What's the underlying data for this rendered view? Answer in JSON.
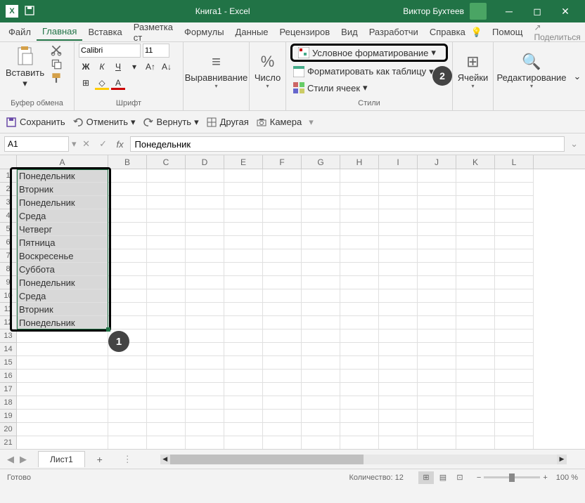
{
  "titlebar": {
    "doc_title": "Книга1",
    "app_name": "Excel",
    "user_name": "Виктор Бухтеев"
  },
  "menubar": {
    "items": [
      "Файл",
      "Главная",
      "Вставка",
      "Разметка ст",
      "Формулы",
      "Данные",
      "Рецензиров",
      "Вид",
      "Разработчи",
      "Справка"
    ],
    "active_index": 1,
    "help_label": "Помощ",
    "share_label": "Поделиться"
  },
  "ribbon": {
    "clipboard": {
      "paste": "Вставить",
      "label": "Буфер обмена"
    },
    "font": {
      "name": "Calibri",
      "size": "11",
      "label": "Шрифт",
      "bold": "Ж",
      "italic": "К",
      "underline": "Ч"
    },
    "alignment": {
      "label": "Выравнивание"
    },
    "number": {
      "label": "Число",
      "percent": "%"
    },
    "styles": {
      "conditional": "Условное форматирование",
      "format_table": "Форматировать как таблицу",
      "cell_styles": "Стили ячеек",
      "label": "Стили"
    },
    "cells": {
      "label": "Ячейки"
    },
    "editing": {
      "label": "Редактирование"
    }
  },
  "qat": {
    "save": "Сохранить",
    "undo": "Отменить",
    "redo": "Вернуть",
    "other": "Другая",
    "camera": "Камера"
  },
  "formula_bar": {
    "name_box": "A1",
    "value": "Понедельник"
  },
  "grid": {
    "columns": [
      "A",
      "B",
      "C",
      "D",
      "E",
      "F",
      "G",
      "H",
      "I",
      "J",
      "K",
      "L"
    ],
    "data": [
      "Понедельник",
      "Вторник",
      "Понедельник",
      "Среда",
      "Четверг",
      "Пятница",
      "Воскресенье",
      "Суббота",
      "Понедельник",
      "Среда",
      "Вторник",
      "Понедельник"
    ],
    "visible_rows": 21
  },
  "callouts": {
    "one": "1",
    "two": "2"
  },
  "sheets": {
    "tab": "Лист1"
  },
  "statusbar": {
    "status": "Готово",
    "count_label": "Количество:",
    "count_value": "12",
    "zoom": "100 %"
  }
}
